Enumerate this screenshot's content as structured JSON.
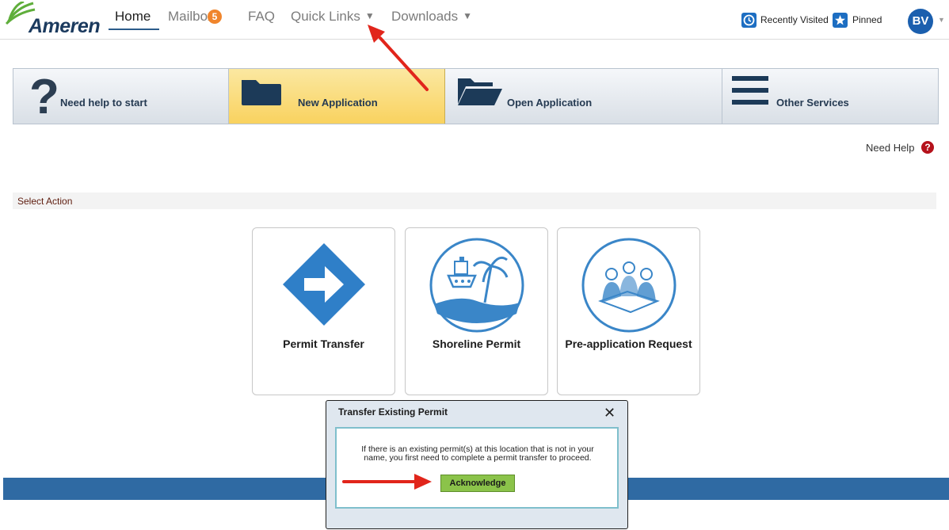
{
  "header": {
    "logo_text": "Ameren",
    "nav": {
      "home": "Home",
      "mailbox": "Mailbox",
      "mailbox_count": "5",
      "faq": "FAQ",
      "quick_links": "Quick Links",
      "downloads": "Downloads"
    },
    "recently_visited": "Recently Visited",
    "pinned": "Pinned",
    "avatar_initials": "BV"
  },
  "tabs": [
    {
      "label": "Need help to start",
      "icon": "question-icon"
    },
    {
      "label": "New Application",
      "icon": "folder-icon",
      "active": true
    },
    {
      "label": "Open Application",
      "icon": "open-folder-icon"
    },
    {
      "label": "Other Services",
      "icon": "menu-icon"
    }
  ],
  "help": {
    "label": "Need Help"
  },
  "section": {
    "title": "Select Action"
  },
  "cards": [
    {
      "label": "Permit Transfer",
      "icon": "transfer-arrow-icon"
    },
    {
      "label": "Shoreline Permit",
      "icon": "shoreline-icon"
    },
    {
      "label": "Pre-application Request",
      "icon": "meeting-icon"
    }
  ],
  "modal": {
    "title": "Transfer Existing Permit",
    "body_line1": "If there is an existing permit(s) at this location that is not in your",
    "body_line2": "name, you first need to complete a permit transfer to proceed.",
    "button_label": "Acknowledge"
  },
  "colors": {
    "brand_blue": "#1b3a5e",
    "accent_blue": "#2f6aa3",
    "active_tab": "#f9d25f",
    "badge_orange": "#f0852c",
    "ack_green": "#8bc34a",
    "annotation_red": "#e1251b"
  }
}
